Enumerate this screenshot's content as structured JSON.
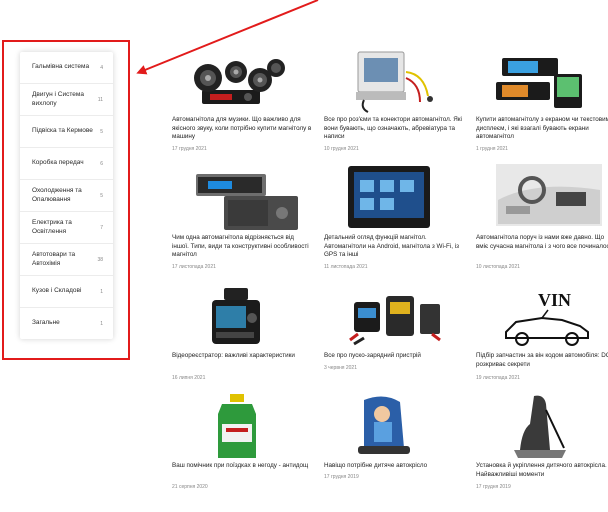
{
  "sidebar": {
    "items": [
      {
        "label": "Гальмівна система",
        "count": "4"
      },
      {
        "label": "Двигун і Система вихлопу",
        "count": "11"
      },
      {
        "label": "Підвіска та Кермове",
        "count": "5"
      },
      {
        "label": "Коробка передач",
        "count": "6"
      },
      {
        "label": "Охолодження та Опалювання",
        "count": "5"
      },
      {
        "label": "Електрика та Освітлення",
        "count": "7"
      },
      {
        "label": "Автотовари та Автохімія",
        "count": "38"
      },
      {
        "label": "Кузов і Складові",
        "count": "1"
      },
      {
        "label": "Загальне",
        "count": "1"
      }
    ]
  },
  "articles": [
    {
      "title": "Автомагнітола для музики. Що важливо для якісного звуку, коли потрібно купити магнітолу в машину",
      "date": "17 грудня 2021",
      "image": "car-stereo-speakers"
    },
    {
      "title": "Все про роз'єми та конектори автомагнітол. Які вони бувають, що означають, абревіатура та написи",
      "date": "10 грудня 2021",
      "image": "stereo-connectors"
    },
    {
      "title": "Купити автомагнітолу з екраном чи текстовим дисплеєм, і які взагалі бувають екрани автомагнітол",
      "date": "1 грудня 2021",
      "image": "stereo-screens"
    },
    {
      "title": "Чим одна автомагнітола відрізняється від іншої. Типи, види та конструктивні особливості магнітол",
      "date": "17 листопада 2021",
      "image": "stereo-types"
    },
    {
      "title": "Детальний огляд функцій магнітол. Автомагнітоли на Android, магнітола з Wi-Fi, із GPS та інші",
      "date": "11 листопада 2021",
      "image": "android-stereo"
    },
    {
      "title": "Автомагнітола поруч із нами вже давно. Що вміє сучасна магнітола і з чого все починалося",
      "date": "10 листопада 2021",
      "image": "car-dashboard"
    },
    {
      "title": "Відеореєстратор: важливі характеристики",
      "date": "16 липня 2021",
      "image": "dashcam"
    },
    {
      "title": "Все про пуско-зарядний пристрій",
      "date": "3 червня 2021",
      "image": "jump-starter"
    },
    {
      "title": "Підбір запчастин за він кодом автомобіля: DOK розкриває секрети",
      "date": "19 листопада 2021",
      "image": "vin-car",
      "vin_text": "VIN"
    },
    {
      "title": "Ваш помічник при поїздках в негоду - антидощ",
      "date": "21 серпня 2020",
      "image": "antirain-bottle"
    },
    {
      "title": "Навіщо потрібне дитяче автокрісло",
      "date": "17 грудня 2019",
      "image": "child-seat"
    },
    {
      "title": "Установка й укріплення дитячого автокрісла. Найважливіші моменти",
      "date": "17 грудня 2019",
      "image": "seat-install"
    }
  ],
  "colors": {
    "annotation": "#e21b1b",
    "text": "#222222",
    "muted": "#888888"
  }
}
